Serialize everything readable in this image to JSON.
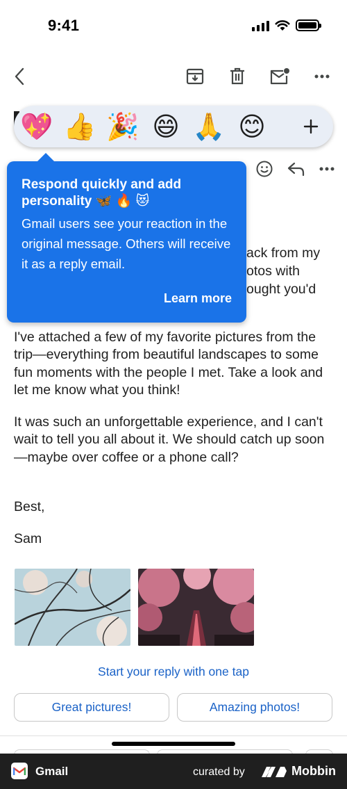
{
  "status_bar": {
    "time": "9:41"
  },
  "toolbar": {
    "back_icon": "chevron-left-icon",
    "archive_icon": "archive-icon",
    "delete_icon": "trash-icon",
    "mark_unread_icon": "mail-unread-icon",
    "more_icon": "more-horizontal-icon"
  },
  "reactions": {
    "items": [
      {
        "emoji": "💖",
        "name": "sparkling-heart"
      },
      {
        "emoji": "👍",
        "name": "thumbs-up"
      },
      {
        "emoji": "🎉",
        "name": "party-popper"
      },
      {
        "emoji": "😄",
        "name": "grinning-face"
      },
      {
        "emoji": "🙏",
        "name": "folded-hands"
      },
      {
        "emoji": "😊",
        "name": "smiling-face"
      }
    ],
    "add_label": "+"
  },
  "tooltip": {
    "title": "Respond quickly and add personality 🦋 🔥 😻",
    "body": "Gmail users see your reaction in the original message. Others will receive it as a reply email.",
    "link": "Learn more"
  },
  "email": {
    "partial_lines": [
      "ack from my",
      "otos with",
      "ought you'd"
    ],
    "paragraphs": [
      "I've attached a few of my favorite pictures from the trip—everything from beautiful landscapes to some fun moments with the people I met. Take a look and let me know what you think!",
      "It was such an unforgettable experience, and I can't wait to tell you all about it. We should catch up soon—maybe over coffee or a phone call?",
      "Best,",
      "Sam"
    ]
  },
  "smart_reply": {
    "prompt": "Start your reply with one tap",
    "chips": [
      "Great pictures!",
      "Amazing photos!"
    ]
  },
  "footer": {
    "app_name": "Gmail",
    "curated_by": "curated by",
    "brand": "Mobbin"
  },
  "colors": {
    "accent_blue": "#1a73e8",
    "link_blue": "#1a62c7",
    "reaction_bar_bg": "#e9eef6",
    "footer_bg": "#1f1f1f"
  }
}
